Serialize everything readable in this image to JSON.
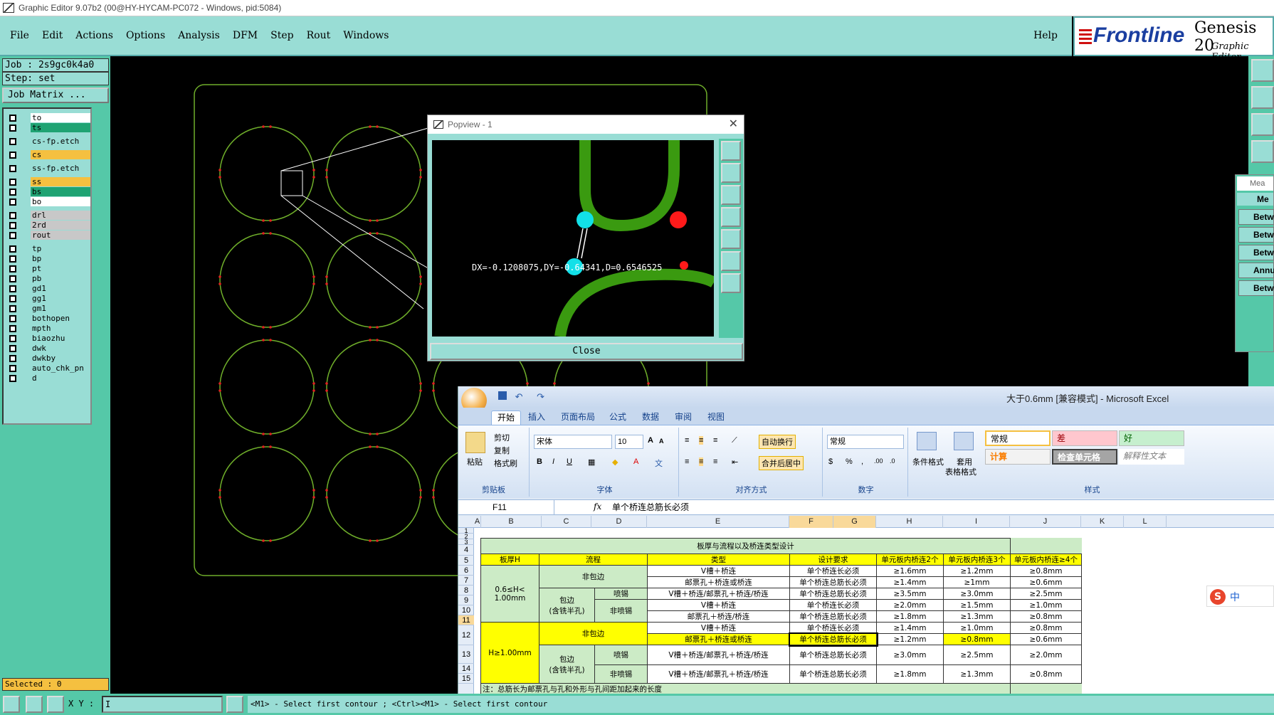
{
  "window": {
    "title": "Graphic Editor 9.07b2 (00@HY-HYCAM-PC072 - Windows, pid:5084)"
  },
  "menu": {
    "items": [
      "File",
      "Edit",
      "Actions",
      "Options",
      "Analysis",
      "DFM",
      "Step",
      "Rout",
      "Windows"
    ],
    "help": "Help"
  },
  "logo": {
    "frontline": "Frontline",
    "genesis": "Genesis 20",
    "subtitle": "Graphic Editor"
  },
  "job": {
    "job_line": "Job : 2s9gc0k4a0",
    "step_line": "Step: set",
    "matrix_button": "Job Matrix ..."
  },
  "layers": [
    {
      "name": "to",
      "color": "#ffffff"
    },
    {
      "name": "ts",
      "color": "#1fa373"
    },
    {
      "name": "cs-fp.etch",
      "color": "#99ddd5"
    },
    {
      "name": "cs",
      "color": "#f5c040"
    },
    {
      "name": "ss-fp.etch",
      "color": "#99ddd5"
    },
    {
      "name": "ss",
      "color": "#f5c040"
    },
    {
      "name": "bs",
      "color": "#1fa373"
    },
    {
      "name": "bo",
      "color": "#ffffff"
    },
    {
      "name": "drl",
      "color": "#c8c8c8"
    },
    {
      "name": "2rd",
      "color": "#c8c8c8"
    },
    {
      "name": "rout",
      "color": "#c8c8c8"
    },
    {
      "name": "tp",
      "color": "#99ddd5"
    },
    {
      "name": "bp",
      "color": "#99ddd5"
    },
    {
      "name": "pt",
      "color": "#99ddd5"
    },
    {
      "name": "pb",
      "color": "#99ddd5"
    },
    {
      "name": "gd1",
      "color": "#99ddd5"
    },
    {
      "name": "gg1",
      "color": "#99ddd5"
    },
    {
      "name": "gm1",
      "color": "#99ddd5"
    },
    {
      "name": "bothopen",
      "color": "#99ddd5"
    },
    {
      "name": "mpth",
      "color": "#99ddd5"
    },
    {
      "name": "biaozhu",
      "color": "#99ddd5"
    },
    {
      "name": "dwk",
      "color": "#99ddd5"
    },
    {
      "name": "dwkby",
      "color": "#99ddd5"
    },
    {
      "name": "auto_chk_pn",
      "color": "#99ddd5"
    },
    {
      "name": "d",
      "color": "#99ddd5"
    }
  ],
  "selected": "Selected : 0",
  "popview": {
    "title": "Popview - 1",
    "measure_text": "DX=-0.1208075,DY=-0.64341,D=0.6546525",
    "close": "Close"
  },
  "measure_panel": {
    "title": "Mea",
    "header": "Me",
    "rows": [
      "Betw",
      "Betw",
      "Betw",
      "Annu",
      "Betw"
    ]
  },
  "bottom": {
    "xy_label": "X Y :",
    "status": "<M1> - Select first contour ; <Ctrl><M1> - Select first contour"
  },
  "excel": {
    "title": "大于0.6mm  [兼容模式] - Microsoft Excel",
    "tabs": [
      "开始",
      "插入",
      "页面布局",
      "公式",
      "数据",
      "审阅",
      "视图"
    ],
    "clipboard": {
      "paste": "粘贴",
      "cut": "剪切",
      "copy": "复制",
      "painter": "格式刷",
      "label": "剪贴板"
    },
    "font": {
      "name": "宋体",
      "size": "10",
      "label": "字体"
    },
    "alignment": {
      "wrap": "自动换行",
      "merge": "合并后居中",
      "label": "对齐方式"
    },
    "number": {
      "format": "常规",
      "label": "数字"
    },
    "styles": {
      "cond": "条件格式",
      "table": "套用",
      "table2": "表格格式",
      "normal": "常规",
      "bad": "差",
      "good": "好",
      "calc": "计算",
      "check": "检查单元格",
      "explain": "解释性文本",
      "label": "样式"
    },
    "namebox": "F11",
    "fx": "fx",
    "formula": "单个桥连总筋长必须",
    "columns": [
      "A",
      "B",
      "C",
      "D",
      "E",
      "F",
      "G",
      "H",
      "I",
      "J",
      "K",
      "L"
    ],
    "rows": [
      "1",
      "2",
      "3",
      "4",
      "5",
      "6",
      "7",
      "8",
      "9",
      "10",
      "11",
      "12",
      "13",
      "14",
      "15"
    ],
    "table": {
      "title": "板厚与流程以及桥连类型设计",
      "headers": [
        "板厚H",
        "流程",
        "类型",
        "设计要求",
        "单元板内桥连2个",
        "单元板内桥连3个",
        "单元板内桥连≥4个"
      ],
      "h1": "0.6≤H<\n1.00mm",
      "h2": "H≥1.00mm",
      "nonwrap": "非包边",
      "wrap": "包边\n(含铣半孔)",
      "spray": "喷锡",
      "nospray": "非喷锡",
      "r5": [
        "V槽＋桥连",
        "单个桥连长必须",
        "≥1.6mm",
        "≥1.2mm",
        "≥0.8mm"
      ],
      "r6": [
        "邮票孔＋桥连或桥连",
        "单个桥连总筋长必须",
        "≥1.4mm",
        "≥1mm",
        "≥0.6mm"
      ],
      "r7": [
        "V槽＋桥连/邮票孔＋桥连/桥连",
        "单个桥连总筋长必须",
        "≥3.5mm",
        "≥3.0mm",
        "≥2.5mm"
      ],
      "r8": [
        "V槽＋桥连",
        "单个桥连长必须",
        "≥2.0mm",
        "≥1.5mm",
        "≥1.0mm"
      ],
      "r9": [
        "邮票孔＋桥连/桥连",
        "单个桥连总筋长必须",
        "≥1.8mm",
        "≥1.3mm",
        "≥0.8mm"
      ],
      "r10": [
        "V槽＋桥连",
        "单个桥连长必须",
        "≥1.4mm",
        "≥1.0mm",
        "≥0.8mm"
      ],
      "r11": [
        "邮票孔＋桥连或桥连",
        "单个桥连总筋长必须",
        "≥1.2mm",
        "≥0.8mm",
        "≥0.6mm"
      ],
      "r12": [
        "V槽＋桥连/邮票孔＋桥连/桥连",
        "单个桥连总筋长必须",
        "≥3.0mm",
        "≥2.5mm",
        "≥2.0mm"
      ],
      "r13": [
        "V槽＋桥连/邮票孔＋桥连/桥连",
        "单个桥连总筋长必须",
        "≥1.8mm",
        "≥1.3mm",
        "≥0.8mm"
      ],
      "note": "注：总筋长为邮票孔与孔和外形与孔间距加起来的长度"
    }
  },
  "ime": {
    "text": "中"
  },
  "colors": {
    "panel_light": "#99ddd5",
    "panel_dark": "#55c8a8",
    "board_outline": "#6fae2a",
    "highlight": "#ffff00"
  }
}
